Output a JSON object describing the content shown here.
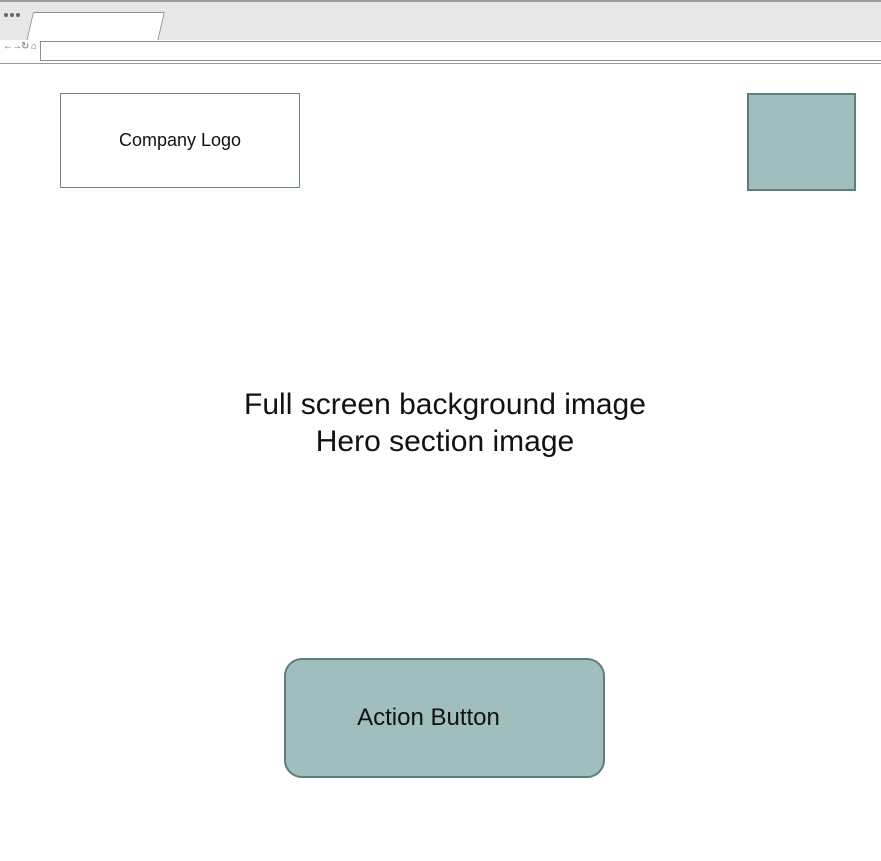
{
  "browser": {
    "tab_title": "",
    "address_value": "",
    "nav_icons": {
      "back": "←",
      "forward": "→",
      "refresh": "↻",
      "home": "⌂"
    }
  },
  "page": {
    "logo_text": "Company Logo",
    "hero_line_1": "Full screen background image",
    "hero_line_2": "Hero section image",
    "action_button_label": "Action Button"
  },
  "colors": {
    "accent": "#9fbebd",
    "accent_border": "#5f7d7b"
  }
}
